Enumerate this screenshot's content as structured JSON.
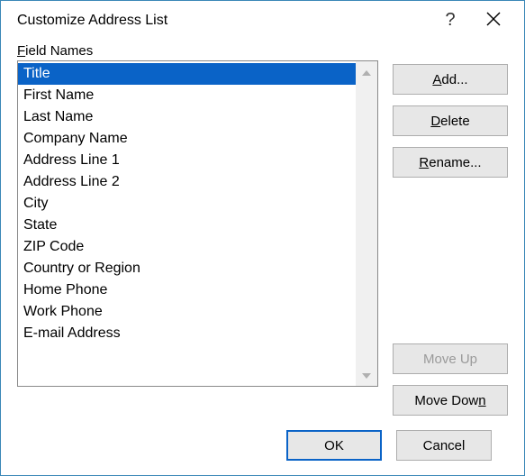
{
  "title": "Customize Address List",
  "help_symbol": "?",
  "section_label_pre": "F",
  "section_label_post": "ield Names",
  "fields": [
    "Title",
    "First Name",
    "Last Name",
    "Company Name",
    "Address Line 1",
    "Address Line 2",
    "City",
    "State",
    "ZIP Code",
    "Country or Region",
    "Home Phone",
    "Work Phone",
    "E-mail Address"
  ],
  "selected_index": 0,
  "buttons": {
    "add_pre": "A",
    "add_post": "dd...",
    "delete_pre": "D",
    "delete_post": "elete",
    "rename_pre": "R",
    "rename_post": "ename...",
    "moveup": "Move Up",
    "movedown_pre": "Move Dow",
    "movedown_post": "n",
    "ok": "OK",
    "cancel": "Cancel"
  },
  "move_up_enabled": false
}
